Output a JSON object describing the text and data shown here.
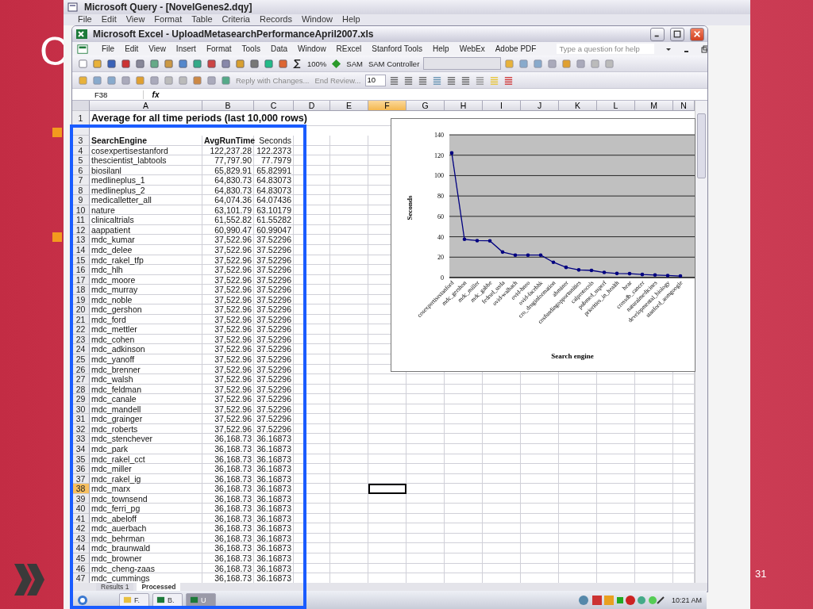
{
  "slide": {
    "title": "C",
    "page_number": "31"
  },
  "query_window": {
    "title": "Microsoft Query - [NovelGenes2.dqy]",
    "menu": [
      "File",
      "Edit",
      "View",
      "Format",
      "Table",
      "Criteria",
      "Records",
      "Window",
      "Help"
    ]
  },
  "excel": {
    "title": "Microsoft Excel - UploadMetasearchPerformanceApril2007.xls",
    "menu": [
      "File",
      "Edit",
      "View",
      "Insert",
      "Format",
      "Tools",
      "Data",
      "Window",
      "RExcel",
      "Stanford Tools",
      "Help",
      "WebEx",
      "Adobe PDF"
    ],
    "help_placeholder": "Type a question for help",
    "toolbar": {
      "zoom": "100%",
      "sam": "SAM",
      "sam_controller": "SAM Controller",
      "reply": "Reply with Changes...",
      "end_review": "End Review...",
      "font_size": "10"
    },
    "name_box": "F38",
    "fx": "fx",
    "columns": [
      {
        "label": "A",
        "selected": false
      },
      {
        "label": "B",
        "selected": false
      },
      {
        "label": "C",
        "selected": false
      },
      {
        "label": "D",
        "selected": false
      },
      {
        "label": "E",
        "selected": false
      },
      {
        "label": "F",
        "selected": true
      },
      {
        "label": "G",
        "selected": false
      },
      {
        "label": "H",
        "selected": false
      },
      {
        "label": "I",
        "selected": false
      },
      {
        "label": "J",
        "selected": false
      },
      {
        "label": "K",
        "selected": false
      },
      {
        "label": "L",
        "selected": false
      },
      {
        "label": "M",
        "selected": false
      },
      {
        "label": "N",
        "selected": false
      }
    ],
    "title_row": {
      "row": "1",
      "text": "Average for all time periods (last 10,000 rows)"
    },
    "header_row": {
      "row": "3",
      "cells": [
        "SearchEngine",
        "AvgRunTime",
        "Seconds"
      ]
    },
    "rows": [
      {
        "row": "4",
        "engine": "cosexpertisestanford",
        "avg_run_time": "122,237.28",
        "seconds": "122.2373",
        "selected": false
      },
      {
        "row": "5",
        "engine": "thescientist_labtools",
        "avg_run_time": "77,797.90",
        "seconds": "77.7979",
        "selected": false
      },
      {
        "row": "6",
        "engine": "biosilanl",
        "avg_run_time": "65,829.91",
        "seconds": "65.82991",
        "selected": false
      },
      {
        "row": "7",
        "engine": "medlineplus_1",
        "avg_run_time": "64,830.73",
        "seconds": "64.83073",
        "selected": false
      },
      {
        "row": "8",
        "engine": "medlineplus_2",
        "avg_run_time": "64,830.73",
        "seconds": "64.83073",
        "selected": false
      },
      {
        "row": "9",
        "engine": "medicalletter_all",
        "avg_run_time": "64,074.36",
        "seconds": "64.07436",
        "selected": false
      },
      {
        "row": "10",
        "engine": "nature",
        "avg_run_time": "63,101.79",
        "seconds": "63.10179",
        "selected": false
      },
      {
        "row": "11",
        "engine": "clinicaltrials",
        "avg_run_time": "61,552.82",
        "seconds": "61.55282",
        "selected": false
      },
      {
        "row": "12",
        "engine": "aappatient",
        "avg_run_time": "60,990.47",
        "seconds": "60.99047",
        "selected": false
      },
      {
        "row": "13",
        "engine": "mdc_kumar",
        "avg_run_time": "37,522.96",
        "seconds": "37.52296",
        "selected": false
      },
      {
        "row": "14",
        "engine": "mdc_delee",
        "avg_run_time": "37,522.96",
        "seconds": "37.52296",
        "selected": false
      },
      {
        "row": "15",
        "engine": "mdc_rakel_tfp",
        "avg_run_time": "37,522.96",
        "seconds": "37.52296",
        "selected": false
      },
      {
        "row": "16",
        "engine": "mdc_hlh",
        "avg_run_time": "37,522.96",
        "seconds": "37.52296",
        "selected": false
      },
      {
        "row": "17",
        "engine": "mdc_moore",
        "avg_run_time": "37,522.96",
        "seconds": "37.52296",
        "selected": false
      },
      {
        "row": "18",
        "engine": "mdc_murray",
        "avg_run_time": "37,522.96",
        "seconds": "37.52296",
        "selected": false
      },
      {
        "row": "19",
        "engine": "mdc_noble",
        "avg_run_time": "37,522.96",
        "seconds": "37.52296",
        "selected": false
      },
      {
        "row": "20",
        "engine": "mdc_gershon",
        "avg_run_time": "37,522.96",
        "seconds": "37.52296",
        "selected": false
      },
      {
        "row": "21",
        "engine": "mdc_ford",
        "avg_run_time": "37,522.96",
        "seconds": "37.52296",
        "selected": false
      },
      {
        "row": "22",
        "engine": "mdc_mettler",
        "avg_run_time": "37,522.96",
        "seconds": "37.52296",
        "selected": false
      },
      {
        "row": "23",
        "engine": "mdc_cohen",
        "avg_run_time": "37,522.96",
        "seconds": "37.52296",
        "selected": false
      },
      {
        "row": "24",
        "engine": "mdc_adkinson",
        "avg_run_time": "37,522.96",
        "seconds": "37.52296",
        "selected": false
      },
      {
        "row": "25",
        "engine": "mdc_yanoff",
        "avg_run_time": "37,522.96",
        "seconds": "37.52296",
        "selected": false
      },
      {
        "row": "26",
        "engine": "mdc_brenner",
        "avg_run_time": "37,522.96",
        "seconds": "37.52296",
        "selected": false
      },
      {
        "row": "27",
        "engine": "mdc_walsh",
        "avg_run_time": "37,522.96",
        "seconds": "37.52296",
        "selected": false
      },
      {
        "row": "28",
        "engine": "mdc_feldman",
        "avg_run_time": "37,522.96",
        "seconds": "37.52296",
        "selected": false
      },
      {
        "row": "29",
        "engine": "mdc_canale",
        "avg_run_time": "37,522.96",
        "seconds": "37.52296",
        "selected": false
      },
      {
        "row": "30",
        "engine": "mdc_mandell",
        "avg_run_time": "37,522.96",
        "seconds": "37.52296",
        "selected": false
      },
      {
        "row": "31",
        "engine": "mdc_grainger",
        "avg_run_time": "37,522.96",
        "seconds": "37.52296",
        "selected": false
      },
      {
        "row": "32",
        "engine": "mdc_roberts",
        "avg_run_time": "37,522.96",
        "seconds": "37.52296",
        "selected": false
      },
      {
        "row": "33",
        "engine": "mdc_stenchever",
        "avg_run_time": "36,168.73",
        "seconds": "36.16873",
        "selected": false
      },
      {
        "row": "34",
        "engine": "mdc_park",
        "avg_run_time": "36,168.73",
        "seconds": "36.16873",
        "selected": false
      },
      {
        "row": "35",
        "engine": "mdc_rakel_cct",
        "avg_run_time": "36,168.73",
        "seconds": "36.16873",
        "selected": false
      },
      {
        "row": "36",
        "engine": "mdc_miller",
        "avg_run_time": "36,168.73",
        "seconds": "36.16873",
        "selected": false
      },
      {
        "row": "37",
        "engine": "mdc_rakel_ig",
        "avg_run_time": "36,168.73",
        "seconds": "36.16873",
        "selected": false
      },
      {
        "row": "38",
        "engine": "mdc_marx",
        "avg_run_time": "36,168.73",
        "seconds": "36.16873",
        "selected": true
      },
      {
        "row": "39",
        "engine": "mdc_townsend",
        "avg_run_time": "36,168.73",
        "seconds": "36.16873",
        "selected": false
      },
      {
        "row": "40",
        "engine": "mdc_ferri_pg",
        "avg_run_time": "36,168.73",
        "seconds": "36.16873",
        "selected": false
      },
      {
        "row": "41",
        "engine": "mdc_abeloff",
        "avg_run_time": "36,168.73",
        "seconds": "36.16873",
        "selected": false
      },
      {
        "row": "42",
        "engine": "mdc_auerbach",
        "avg_run_time": "36,168.73",
        "seconds": "36.16873",
        "selected": false
      },
      {
        "row": "43",
        "engine": "mdc_behrman",
        "avg_run_time": "36,168.73",
        "seconds": "36.16873",
        "selected": false
      },
      {
        "row": "44",
        "engine": "mdc_braunwald",
        "avg_run_time": "36,168.73",
        "seconds": "36.16873",
        "selected": false
      },
      {
        "row": "45",
        "engine": "mdc_browner",
        "avg_run_time": "36,168.73",
        "seconds": "36.16873",
        "selected": false
      },
      {
        "row": "46",
        "engine": "mdc_cheng-zaas",
        "avg_run_time": "36,168.73",
        "seconds": "36.16873",
        "selected": false
      },
      {
        "row": "47",
        "engine": "mdc_cummings",
        "avg_run_time": "36,168.73",
        "seconds": "36.16873",
        "selected": false
      }
    ],
    "chart": {
      "chart_data": {
        "type": "line",
        "xlabel": "Search engine",
        "ylabel": "Seconds",
        "categories": [
          "cosexpertisestanford",
          "mdc_gershon",
          "mdc_miller",
          "mdc_gabbe",
          "fedrud_usda",
          "ovid-walbach",
          "ovid-hneo",
          "ovid-facebhk",
          "cro_druginformation",
          "abminer",
          "cosfundingopportunities",
          "calprotocols",
          "pubmed_usperf",
          "priorities_in_health",
          "hear",
          "crossdb_cancer",
          "naturalmedicines",
          "developmental_biology",
          "stanford_aomgoogle"
        ],
        "series": [
          {
            "color": "#000080",
            "values": [
              122.2,
              37.5,
              36.2,
              36,
              25,
              22,
              22,
              22,
              15,
              10,
              7.5,
              7,
              5,
              4,
              3.8,
              3,
              2.5,
              2,
              1.5
            ]
          }
        ],
        "ylim": [
          0,
          140
        ],
        "grid": true,
        "yticks": [
          0,
          20,
          40,
          60,
          80,
          100,
          120,
          140
        ]
      }
    },
    "sheet_tabs": [
      {
        "label": "Results 1",
        "selected": false
      },
      {
        "label": "Processed",
        "selected": true
      }
    ]
  },
  "taskbar": {
    "items": [
      {
        "label": "F.",
        "selected": false
      },
      {
        "label": "B.",
        "selected": false
      },
      {
        "label": "U",
        "selected": true
      }
    ],
    "clock": "10:21 AM"
  }
}
